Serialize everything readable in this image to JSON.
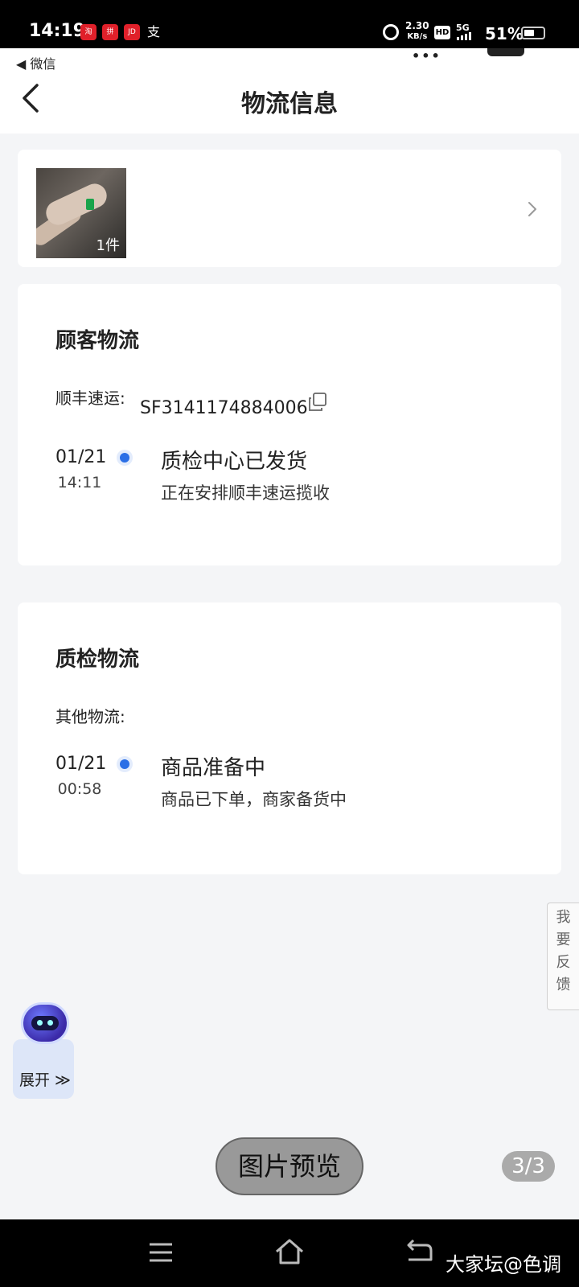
{
  "status_bar": {
    "time": "14:19",
    "app_icons": [
      {
        "name": "taobao-icon",
        "color": "#e0202a"
      },
      {
        "name": "pinduoduo-icon",
        "color": "#e0202a"
      },
      {
        "name": "jd-icon",
        "color": "#e0202a"
      },
      {
        "name": "alipay-icon",
        "color": "#ffffff"
      }
    ],
    "net_speed_value": "2.30",
    "net_speed_unit": "KB/s",
    "hd": "HD",
    "network": "5G",
    "battery": "51%",
    "battery_level": 0.51
  },
  "header": {
    "back_app": "◀ 微信",
    "title": "物流信息"
  },
  "product": {
    "quantity": "1件"
  },
  "customer_logistics": {
    "title": "顾客物流",
    "carrier": "顺丰速运:",
    "tracking_no": "SF3141174884006",
    "event": {
      "date": "01/21",
      "time": "14:11",
      "title": "质检中心已发货",
      "desc": "正在安排顺丰速运揽收"
    }
  },
  "qc_logistics": {
    "title": "质检物流",
    "carrier": "其他物流:",
    "event": {
      "date": "01/21",
      "time": "00:58",
      "title": "商品准备中",
      "desc": "商品已下单，商家备货中"
    }
  },
  "feedback": {
    "label_lines": [
      "我",
      "要",
      "反",
      "馈"
    ]
  },
  "assistant": {
    "expand_label": "展开 ≫"
  },
  "preview": {
    "label": "图片预览",
    "page": "3/3"
  },
  "watermark": "大家坛@色调",
  "colors": {
    "accent_blue": "#2b6fe6",
    "background": "#f4f5f7"
  }
}
